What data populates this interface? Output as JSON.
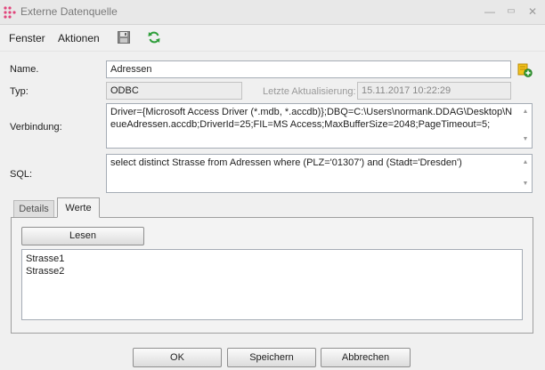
{
  "window": {
    "title": "Externe Datenquelle",
    "minimize_glyph": "—",
    "maximize_glyph": "▭",
    "close_glyph": "✕",
    "app_icon": "dots-logo-icon"
  },
  "menu": {
    "fenster": "Fenster",
    "aktionen": "Aktionen",
    "save_icon": "floppy-disk-icon",
    "refresh_icon": "refresh-icon"
  },
  "form": {
    "name_label": "Name.",
    "name_value": "Adressen",
    "typ_label": "Typ:",
    "typ_value": "ODBC",
    "last_update_label": "Letzte Aktualisierung:",
    "last_update_value": "15.11.2017 10:22:29",
    "verbindung_label": "Verbindung:",
    "verbindung_value": "Driver={Microsoft Access Driver (*.mdb, *.accdb)};DBQ=C:\\Users\\normank.DDAG\\Desktop\\NeueAdressen.accdb;DriverId=25;FIL=MS Access;MaxBufferSize=2048;PageTimeout=5;",
    "sql_label": "SQL:",
    "sql_value": "select distinct Strasse from Adressen where (PLZ='01307') and (Stadt='Dresden')",
    "add_icon": "add-source-icon"
  },
  "tabs": [
    {
      "label": "Details",
      "active": false
    },
    {
      "label": "Werte",
      "active": true
    }
  ],
  "werte": {
    "lesen_label": "Lesen",
    "values": [
      "Strasse1",
      "Strasse2"
    ]
  },
  "footer": {
    "ok_label": "OK",
    "speichern_label": "Speichern",
    "abbrechen_label": "Abbrechen"
  },
  "colors": {
    "accent_pink": "#e0457b",
    "refresh_green": "#2e9e3a",
    "add_yellow": "#f2c21b"
  }
}
